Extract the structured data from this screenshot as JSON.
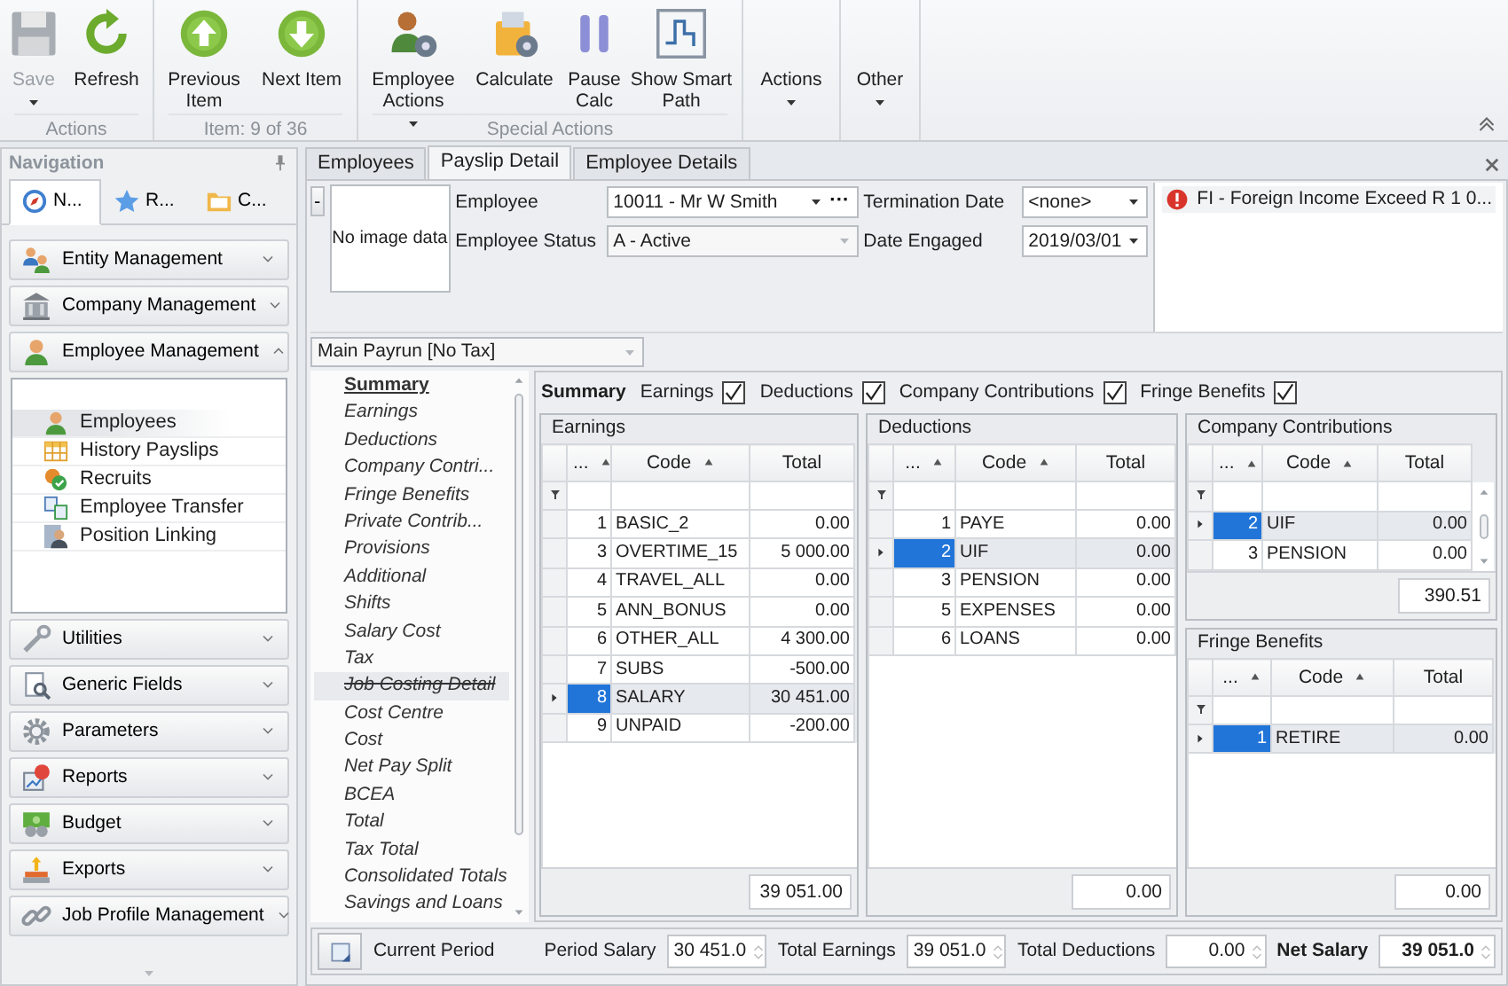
{
  "ribbon": {
    "groups": [
      {
        "label": "Actions",
        "buttons": [
          {
            "label": "Save",
            "disabled": true,
            "dropdown": true
          },
          {
            "label": "Refresh",
            "disabled": false,
            "dropdown": false
          }
        ]
      },
      {
        "label": "Item: 9 of 36",
        "buttons": [
          {
            "label": "Previous Item",
            "disabled": false,
            "dropdown": false
          },
          {
            "label": "Next Item",
            "disabled": false,
            "dropdown": false
          }
        ]
      },
      {
        "label": "Special Actions",
        "buttons": [
          {
            "label": "Employee Actions",
            "disabled": false,
            "dropdown": true
          },
          {
            "label": "Calculate",
            "disabled": false,
            "dropdown": false
          },
          {
            "label": "Pause Calc",
            "disabled": false,
            "dropdown": false
          },
          {
            "label": "Show Smart Path",
            "disabled": false,
            "dropdown": false
          }
        ]
      },
      {
        "buttons": [
          {
            "label": "Actions",
            "disabled": false,
            "dropdown": true
          }
        ]
      },
      {
        "buttons": [
          {
            "label": "Other",
            "disabled": false,
            "dropdown": true
          }
        ]
      }
    ]
  },
  "navigation": {
    "title": "Navigation",
    "tabs": [
      {
        "label": "N...",
        "selected": true
      },
      {
        "label": "R...",
        "selected": false
      },
      {
        "label": "C...",
        "selected": false
      }
    ],
    "groups": [
      {
        "label": "Entity Management",
        "expanded": false
      },
      {
        "label": "Company Management",
        "expanded": false
      },
      {
        "label": "Employee Management",
        "expanded": true,
        "items": [
          {
            "label": "Employees",
            "selected": true
          },
          {
            "label": "History Payslips",
            "selected": false
          },
          {
            "label": "Recruits",
            "selected": false
          },
          {
            "label": "Employee Transfer",
            "selected": false
          },
          {
            "label": "Position Linking",
            "selected": false
          }
        ]
      },
      {
        "label": "Utilities",
        "expanded": false
      },
      {
        "label": "Generic Fields",
        "expanded": false
      },
      {
        "label": "Parameters",
        "expanded": false
      },
      {
        "label": "Reports",
        "expanded": false
      },
      {
        "label": "Budget",
        "expanded": false
      },
      {
        "label": "Exports",
        "expanded": false
      },
      {
        "label": "Job Profile Management",
        "expanded": false
      }
    ]
  },
  "document_tabs": [
    {
      "label": "Employees",
      "selected": false
    },
    {
      "label": "Payslip Detail",
      "selected": true
    },
    {
      "label": "Employee Details",
      "selected": false
    }
  ],
  "employee_header": {
    "collapse_button": "-",
    "photo_placeholder": "No image data",
    "fields": [
      {
        "label": "Employee",
        "value": "10011 - Mr W Smith",
        "disabled": false,
        "button": "···"
      },
      {
        "label": "Employee Status",
        "value": "A - Active",
        "disabled": true
      }
    ],
    "dates": [
      {
        "label": "Termination Date",
        "value": "<none>"
      },
      {
        "label": "Date Engaged",
        "value": "2019/03/01"
      }
    ]
  },
  "alerts": [
    {
      "text": "FI - Foreign Income Exceed R 1 0...",
      "kind": "error"
    }
  ],
  "payrun": {
    "value": "Main Payrun [No Tax]",
    "disabled": true
  },
  "summary_menu": [
    {
      "label": "Summary",
      "kind": "heading",
      "selected": false
    },
    {
      "label": "Earnings",
      "kind": "item",
      "selected": false
    },
    {
      "label": "Deductions",
      "kind": "item",
      "selected": false
    },
    {
      "label": "Company Contri...",
      "kind": "item",
      "selected": false
    },
    {
      "label": "Fringe Benefits",
      "kind": "item",
      "selected": false
    },
    {
      "label": "Private Contrib...",
      "kind": "item",
      "selected": false
    },
    {
      "label": "Provisions",
      "kind": "item",
      "selected": false
    },
    {
      "label": "Additional",
      "kind": "item",
      "selected": false
    },
    {
      "label": "Shifts",
      "kind": "item",
      "selected": false
    },
    {
      "label": "Salary Cost",
      "kind": "item",
      "selected": false
    },
    {
      "label": "Tax",
      "kind": "item",
      "selected": false
    },
    {
      "label": "Job Costing Detail",
      "kind": "struck",
      "selected": true
    },
    {
      "label": "Cost Centre",
      "kind": "item",
      "selected": false
    },
    {
      "label": "Cost",
      "kind": "item",
      "selected": false
    },
    {
      "label": "Net Pay Split",
      "kind": "item",
      "selected": false
    },
    {
      "label": "BCEA",
      "kind": "item",
      "selected": false
    },
    {
      "label": "Total",
      "kind": "item",
      "selected": false
    },
    {
      "label": "Tax Total",
      "kind": "item",
      "selected": false
    },
    {
      "label": "Consolidated Totals",
      "kind": "item",
      "selected": false
    },
    {
      "label": "Savings and Loans",
      "kind": "item",
      "selected": false
    }
  ],
  "summary_options": {
    "title": "Summary",
    "options": [
      {
        "label": "Earnings",
        "checked": true
      },
      {
        "label": "Deductions",
        "checked": true
      },
      {
        "label": "Company Contributions",
        "checked": true
      },
      {
        "label": "Fringe Benefits",
        "checked": true
      }
    ]
  },
  "grids": [
    {
      "title": "Earnings",
      "columns": [
        {
          "label": "...",
          "sorted": true
        },
        {
          "label": "Code",
          "sorted": true
        },
        {
          "label": "Total",
          "sorted": false
        }
      ],
      "rows": [
        {
          "number": "1",
          "code": "BASIC_2",
          "total": "0.00",
          "selected": false
        },
        {
          "number": "3",
          "code": "OVERTIME_15",
          "total": "5 000.00",
          "selected": false
        },
        {
          "number": "4",
          "code": "TRAVEL_ALL",
          "total": "0.00",
          "selected": false
        },
        {
          "number": "5",
          "code": "ANN_BONUS",
          "total": "0.00",
          "selected": false
        },
        {
          "number": "6",
          "code": "OTHER_ALL",
          "total": "4 300.00",
          "selected": false
        },
        {
          "number": "7",
          "code": "SUBS",
          "total": "-500.00",
          "selected": false
        },
        {
          "number": "8",
          "code": "SALARY",
          "total": "30 451.00",
          "selected": true
        },
        {
          "number": "9",
          "code": "UNPAID",
          "total": "-200.00",
          "selected": false
        }
      ],
      "total": "39 051.00"
    },
    {
      "title": "Deductions",
      "columns": [
        {
          "label": "...",
          "sorted": true
        },
        {
          "label": "Code",
          "sorted": true
        },
        {
          "label": "Total",
          "sorted": false
        }
      ],
      "rows": [
        {
          "number": "1",
          "code": "PAYE",
          "total": "0.00",
          "selected": false
        },
        {
          "number": "2",
          "code": "UIF",
          "total": "0.00",
          "selected": true
        },
        {
          "number": "3",
          "code": "PENSION",
          "total": "0.00",
          "selected": false
        },
        {
          "number": "5",
          "code": "EXPENSES",
          "total": "0.00",
          "selected": false
        },
        {
          "number": "6",
          "code": "LOANS",
          "total": "0.00",
          "selected": false
        }
      ],
      "total": "0.00"
    },
    {
      "title": "Company Contributions",
      "columns": [
        {
          "label": "...",
          "sorted": true
        },
        {
          "label": "Code",
          "sorted": true
        },
        {
          "label": "Total",
          "sorted": false
        }
      ],
      "rows": [
        {
          "number": "2",
          "code": "UIF",
          "total": "0.00",
          "selected": true
        },
        {
          "number": "3",
          "code": "PENSION",
          "total": "0.00",
          "selected": false
        }
      ],
      "total": "390.51"
    },
    {
      "title": "Fringe Benefits",
      "columns": [
        {
          "label": "...",
          "sorted": true
        },
        {
          "label": "Code",
          "sorted": true
        },
        {
          "label": "Total",
          "sorted": false
        }
      ],
      "rows": [
        {
          "number": "1",
          "code": "RETIRE",
          "total": "0.00",
          "selected": true
        }
      ],
      "total": "0.00"
    }
  ],
  "period_bar": {
    "label": "Current Period",
    "fields": [
      {
        "label": "Period Salary",
        "value": "30 451.0",
        "kind": "amount"
      },
      {
        "label": "Total Earnings",
        "value": "39 051.0",
        "kind": "amount"
      },
      {
        "label": "Total Deductions",
        "value": "0.00",
        "kind": "amount"
      },
      {
        "label": "Net Salary",
        "value": "39 051.0",
        "kind": "total"
      }
    ]
  }
}
